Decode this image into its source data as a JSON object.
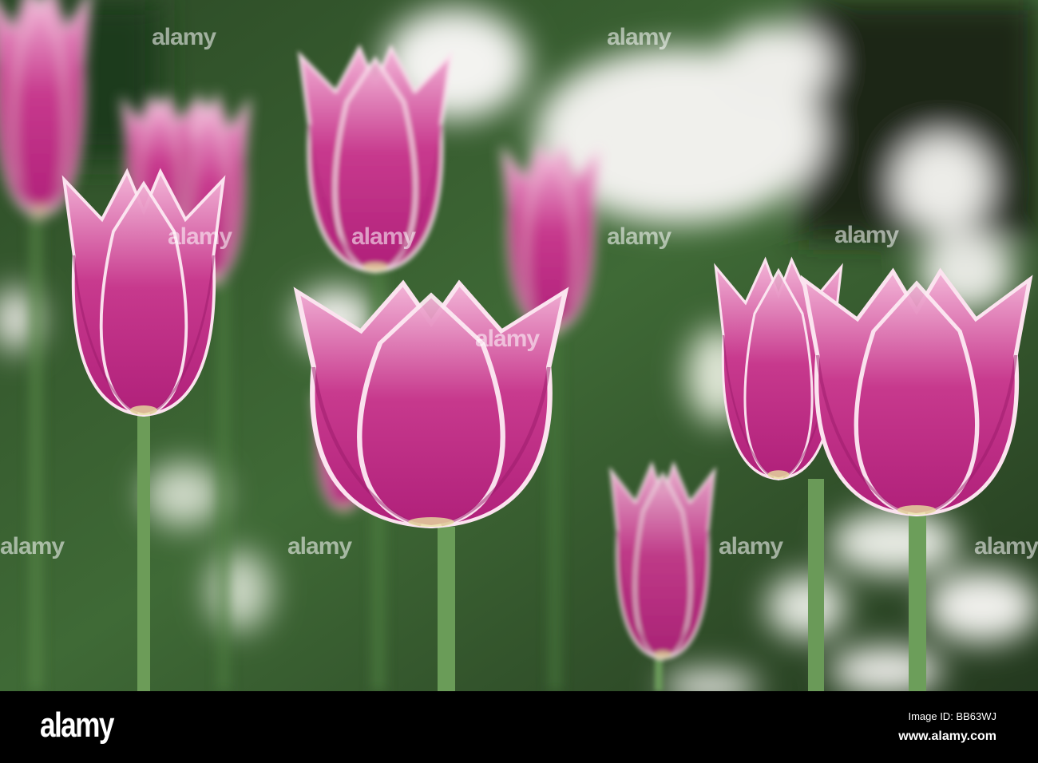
{
  "photo": {
    "subject": "tulips",
    "colors": {
      "tulip": "#c02a80",
      "tulip_light": "#ee8cc4",
      "foliage": "#2f5a2a",
      "dark": "#1a2416",
      "white_flowers": "#f2f2ee"
    }
  },
  "watermark": {
    "text": "alamy"
  },
  "footer": {
    "logo": "alamy",
    "image_id": "Image ID: BB63WJ",
    "site": "www.alamy.com"
  }
}
